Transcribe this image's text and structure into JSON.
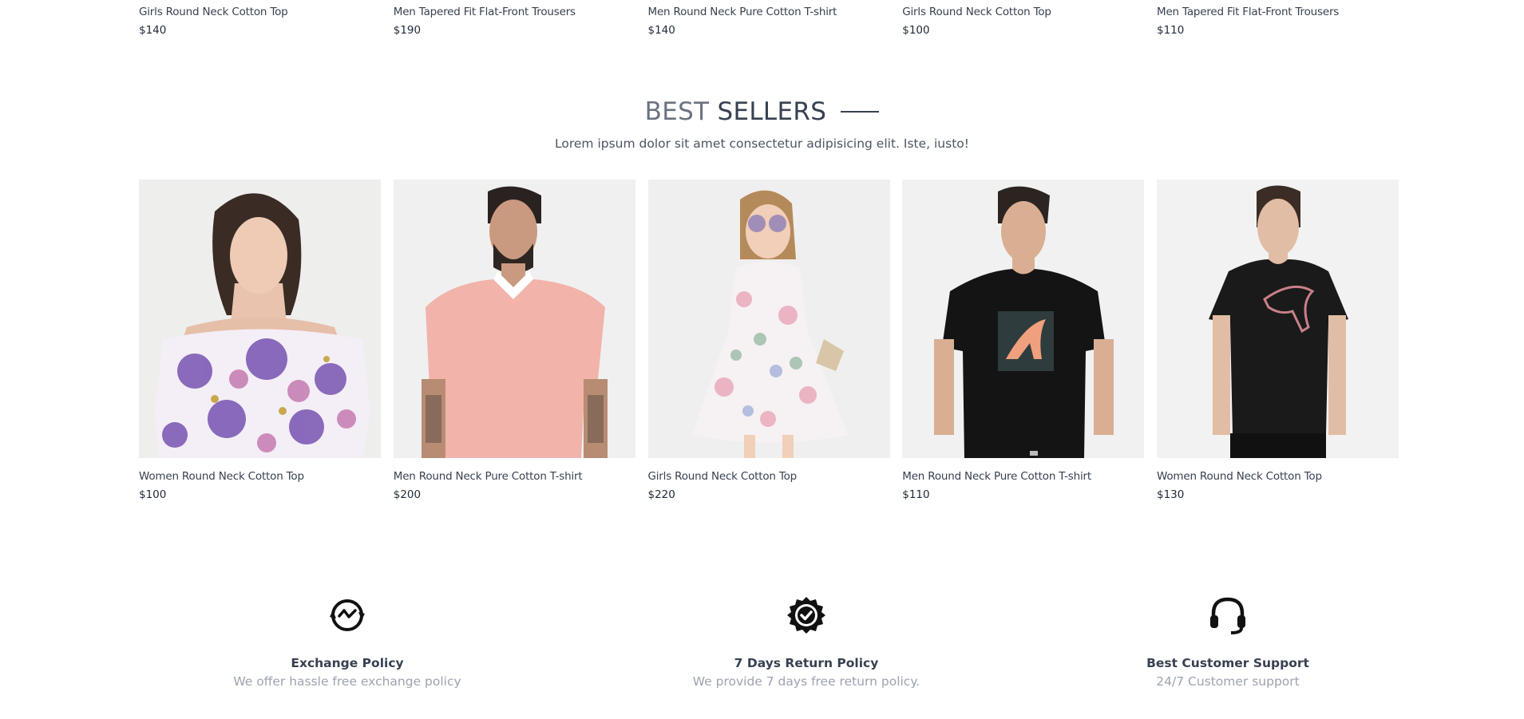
{
  "latest_row": [
    {
      "name": "Girls Round Neck Cotton Top",
      "price": "$140"
    },
    {
      "name": "Men Tapered Fit Flat-Front Trousers",
      "price": "$190"
    },
    {
      "name": "Men Round Neck Pure Cotton T-shirt",
      "price": "$140"
    },
    {
      "name": "Girls Round Neck Cotton Top",
      "price": "$100"
    },
    {
      "name": "Men Tapered Fit Flat-Front Trousers",
      "price": "$110"
    }
  ],
  "best_sellers": {
    "title_light": "BEST",
    "title_bold": "SELLERS",
    "subtitle": "Lorem ipsum dolor sit amet consectetur adipisicing elit. Iste, iusto!",
    "products": [
      {
        "name": "Women Round Neck Cotton Top",
        "price": "$100",
        "image": "woman-floral-off-shoulder-top"
      },
      {
        "name": "Men Round Neck Pure Cotton T-shirt",
        "price": "$200",
        "image": "man-pink-polo-shirt"
      },
      {
        "name": "Girls Round Neck Cotton Top",
        "price": "$220",
        "image": "girl-floral-dress"
      },
      {
        "name": "Men Round Neck Pure Cotton T-shirt",
        "price": "$110",
        "image": "man-black-puma-tshirt"
      },
      {
        "name": "Women Round Neck Cotton Top",
        "price": "$130",
        "image": "woman-black-puma-tshirt"
      }
    ]
  },
  "policies": [
    {
      "title": "Exchange Policy",
      "description": "We offer hassle free exchange policy",
      "icon": "exchange-icon"
    },
    {
      "title": "7 Days Return Policy",
      "description": "We provide 7 days free return policy.",
      "icon": "verified-badge-icon"
    },
    {
      "title": "Best Customer Support",
      "description": "24/7 Customer support",
      "icon": "headset-icon"
    }
  ],
  "colors": {
    "text_dark": "#374151",
    "text_muted": "#9ca3af",
    "image_bg": "#f1f1f1"
  }
}
